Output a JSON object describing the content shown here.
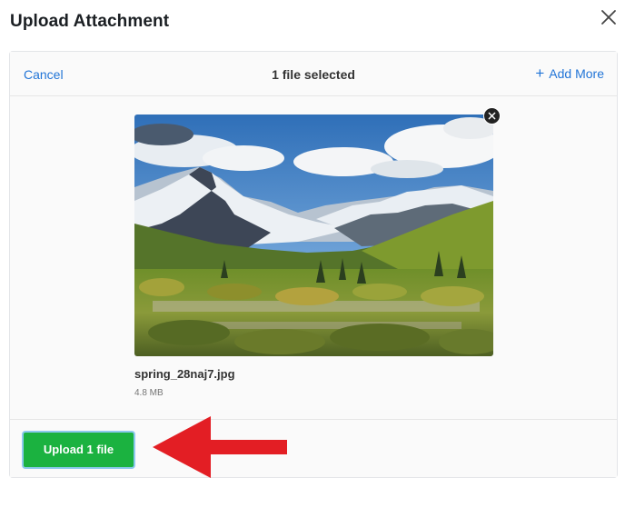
{
  "dialog": {
    "title": "Upload Attachment",
    "close_icon": "close-icon"
  },
  "topbar": {
    "cancel_label": "Cancel",
    "status": "1 file selected",
    "add_more_label": "Add More",
    "add_more_icon": "plus-icon"
  },
  "file": {
    "name": "spring_28naj7.jpg",
    "size": "4.8 MB",
    "preview": "mountain-landscape-image",
    "remove_icon": "remove-file-icon"
  },
  "footer": {
    "upload_label": "Upload 1 file"
  },
  "colors": {
    "link": "#2275d7",
    "upload_button": "#1bb240",
    "annotation_arrow": "#e31e24"
  }
}
